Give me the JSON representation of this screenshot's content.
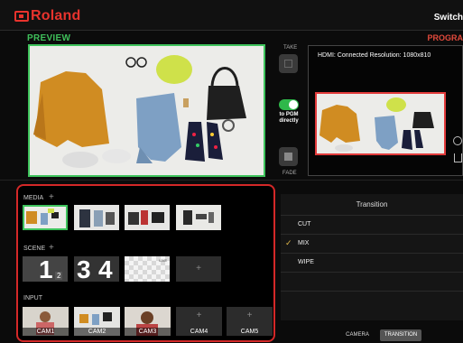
{
  "header": {
    "brand": "Roland",
    "mode_label": "Switch"
  },
  "preview": {
    "label": "PREVIEW"
  },
  "program": {
    "label": "PROGRA",
    "status_text": "HDMI:  Connected  Resolution: 1080x810"
  },
  "controls": {
    "take_label": "TAKE",
    "to_pgm_label": "to PGM directly",
    "fade_label": "FADE"
  },
  "sources": {
    "media_label": "MEDIA",
    "scene_label": "SCENE",
    "input_label": "INPUT",
    "add_symbol": "+",
    "scene_badges": [
      "2"
    ],
    "live_badge": "LIVE",
    "scene_numbers": [
      "1",
      "3",
      "4"
    ],
    "cams": [
      "CAM1",
      "CAM2",
      "CAM3",
      "CAM4",
      "CAM5"
    ]
  },
  "transition": {
    "title": "Transition",
    "options": [
      "CUT",
      "MIX",
      "WIPE"
    ],
    "selected": "MIX",
    "check": "✓"
  },
  "tabs": {
    "camera": "CAMERA",
    "transition": "TRANSITION"
  },
  "colors": {
    "accent": "#e8332d",
    "preview": "#3ec35c",
    "program": "#e23b3b",
    "toggle_on": "#2fb84a"
  }
}
